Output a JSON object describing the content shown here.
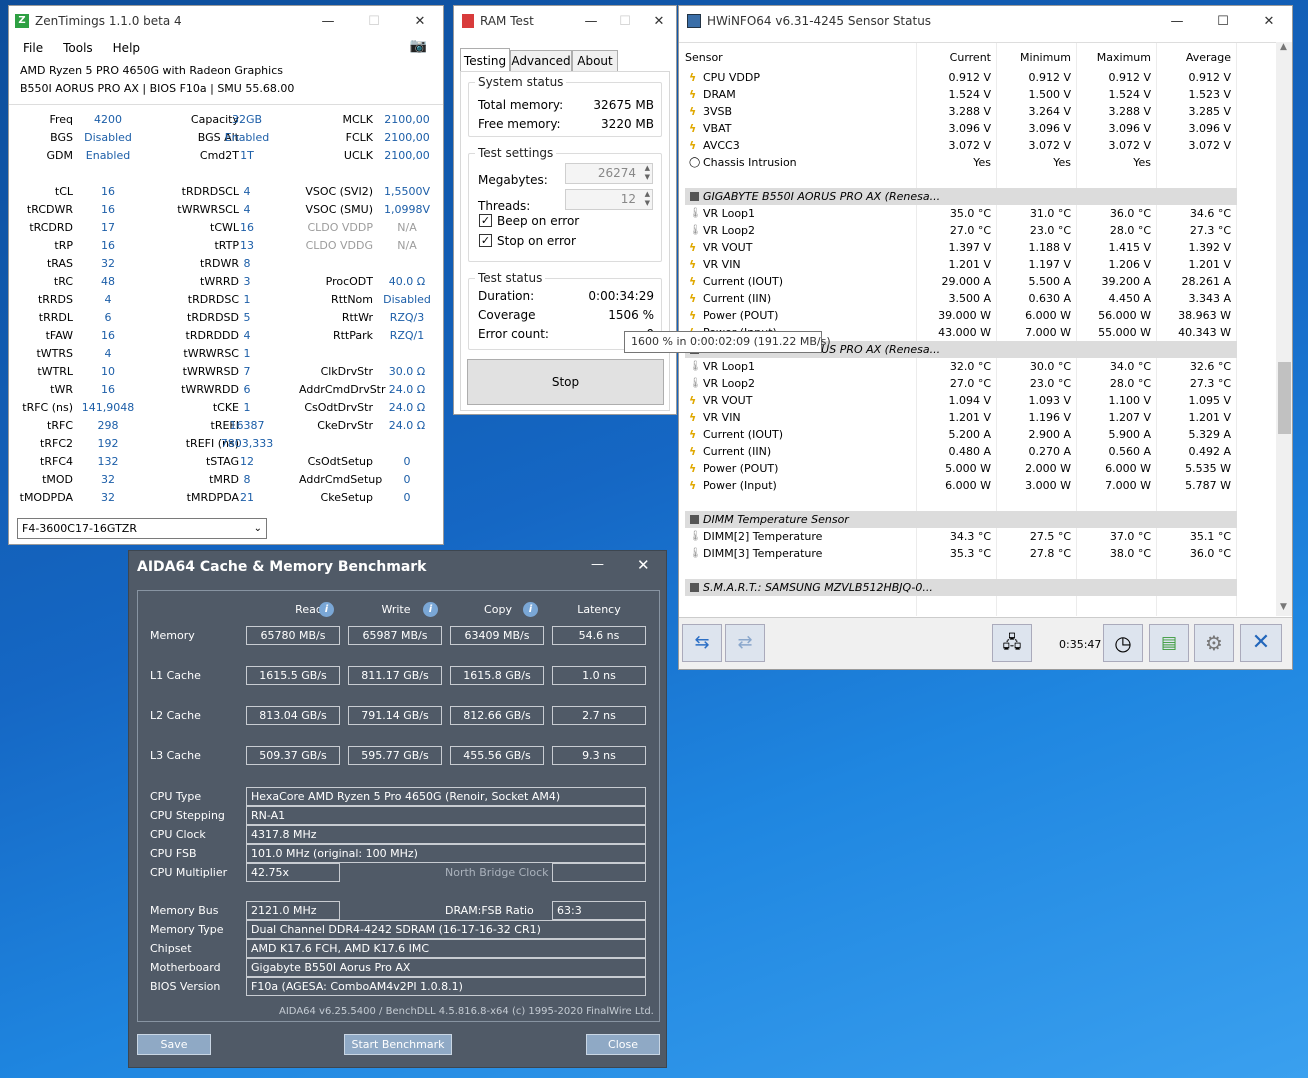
{
  "zen": {
    "title": "ZenTimings 1.1.0 beta 4",
    "menu": [
      "File",
      "Tools",
      "Help"
    ],
    "cpu": "AMD Ryzen 5 PRO 4650G with Radeon Graphics",
    "board": "B550I AORUS PRO AX | BIOS F10a | SMU 55.68.00",
    "rows": [
      [
        "Freq",
        "4200",
        "Capacity",
        "32GB",
        "MCLK",
        "2100,00"
      ],
      [
        "BGS",
        "Disabled",
        "BGS Alt",
        "Enabled",
        "FCLK",
        "2100,00"
      ],
      [
        "GDM",
        "Enabled",
        "Cmd2T",
        "1T",
        "UCLK",
        "2100,00"
      ],
      null,
      [
        "tCL",
        "16",
        "tRDRDSCL",
        "4",
        "VSOC (SVI2)",
        "1,5500V"
      ],
      [
        "tRCDWR",
        "16",
        "tWRWRSCL",
        "4",
        "VSOC (SMU)",
        "1,0998V"
      ],
      [
        "tRCDRD",
        "17",
        "tCWL",
        "16",
        "CLDO VDDP",
        "N/A"
      ],
      [
        "tRP",
        "16",
        "tRTP",
        "13",
        "CLDO VDDG",
        "N/A"
      ],
      [
        "tRAS",
        "32",
        "tRDWR",
        "8",
        "",
        ""
      ],
      [
        "tRC",
        "48",
        "tWRRD",
        "3",
        "ProcODT",
        "40.0 Ω"
      ],
      [
        "tRRDS",
        "4",
        "tRDRDSC",
        "1",
        "RttNom",
        "Disabled"
      ],
      [
        "tRRDL",
        "6",
        "tRDRDSD",
        "5",
        "RttWr",
        "RZQ/3"
      ],
      [
        "tFAW",
        "16",
        "tRDRDDD",
        "4",
        "RttPark",
        "RZQ/1"
      ],
      [
        "tWTRS",
        "4",
        "tWRWRSC",
        "1",
        "",
        ""
      ],
      [
        "tWTRL",
        "10",
        "tWRWRSD",
        "7",
        "ClkDrvStr",
        "30.0 Ω"
      ],
      [
        "tWR",
        "16",
        "tWRWRDD",
        "6",
        "AddrCmdDrvStr",
        "24.0 Ω"
      ],
      [
        "tRFC (ns)",
        "141,9048",
        "tCKE",
        "1",
        "CsOdtDrvStr",
        "24.0 Ω"
      ],
      [
        "tRFC",
        "298",
        "tREFI",
        "16387",
        "CkeDrvStr",
        "24.0 Ω"
      ],
      [
        "tRFC2",
        "192",
        "tREFI (ns)",
        "7803,333",
        "",
        ""
      ],
      [
        "tRFC4",
        "132",
        "tSTAG",
        "12",
        "CsOdtSetup",
        "0"
      ],
      [
        "tMOD",
        "32",
        "tMRD",
        "8",
        "AddrCmdSetup",
        "0"
      ],
      [
        "tMODPDA",
        "32",
        "tMRDPDA",
        "21",
        "CkeSetup",
        "0"
      ]
    ],
    "profile": "F4-3600C17-16GTZR"
  },
  "ram": {
    "title": "RAM Test",
    "tabs": [
      "Testing",
      "Advanced",
      "About"
    ],
    "status_title": "System status",
    "total_label": "Total memory:",
    "total_value": "32675 MB",
    "free_label": "Free memory:",
    "free_value": "3220 MB",
    "settings_title": "Test settings",
    "mb_label": "Megabytes:",
    "mb_value": "26274",
    "threads_label": "Threads:",
    "threads_value": "12",
    "beep_label": "Beep on error",
    "stop_err_label": "Stop on error",
    "test_status_title": "Test status",
    "duration_label": "Duration:",
    "duration_value": "0:00:34:29",
    "coverage_label": "Coverage",
    "coverage_value": "1506 %",
    "errors_label": "Error count:",
    "errors_value": "0",
    "tooltip": "1600 % in 0:00:02:09 (191.22 MB/s)",
    "stop_button": "Stop"
  },
  "hw": {
    "title": "HWiNFO64 v6.31-4245 Sensor Status",
    "headers": [
      "Sensor",
      "Current",
      "Minimum",
      "Maximum",
      "Average"
    ],
    "rows": [
      {
        "n": "CPU VDDP",
        "v": [
          "0.912 V",
          "0.912 V",
          "0.912 V",
          "0.912 V"
        ],
        "i": "bolt"
      },
      {
        "n": "DRAM",
        "v": [
          "1.524 V",
          "1.500 V",
          "1.524 V",
          "1.523 V"
        ],
        "i": "bolt"
      },
      {
        "n": "3VSB",
        "v": [
          "3.288 V",
          "3.264 V",
          "3.288 V",
          "3.285 V"
        ],
        "i": "bolt"
      },
      {
        "n": "VBAT",
        "v": [
          "3.096 V",
          "3.096 V",
          "3.096 V",
          "3.096 V"
        ],
        "i": "bolt"
      },
      {
        "n": "AVCC3",
        "v": [
          "3.072 V",
          "3.072 V",
          "3.072 V",
          "3.072 V"
        ],
        "i": "bolt"
      },
      {
        "n": "Chassis Intrusion",
        "v": [
          "Yes",
          "Yes",
          "Yes",
          ""
        ],
        "i": "circle"
      },
      {
        "blank": true
      },
      {
        "sec": "GIGABYTE B550I AORUS PRO AX (Renesa..."
      },
      {
        "n": "VR Loop1",
        "v": [
          "35.0 °C",
          "31.0 °C",
          "36.0 °C",
          "34.6 °C"
        ],
        "i": "therm"
      },
      {
        "n": "VR Loop2",
        "v": [
          "27.0 °C",
          "23.0 °C",
          "28.0 °C",
          "27.3 °C"
        ],
        "i": "therm"
      },
      {
        "n": "VR VOUT",
        "v": [
          "1.397 V",
          "1.188 V",
          "1.415 V",
          "1.392 V"
        ],
        "i": "bolt"
      },
      {
        "n": "VR VIN",
        "v": [
          "1.201 V",
          "1.197 V",
          "1.206 V",
          "1.201 V"
        ],
        "i": "bolt"
      },
      {
        "n": "Current (IOUT)",
        "v": [
          "29.000 A",
          "5.500 A",
          "39.200 A",
          "28.261 A"
        ],
        "i": "bolt"
      },
      {
        "n": "Current (IIN)",
        "v": [
          "3.500 A",
          "0.630 A",
          "4.450 A",
          "3.343 A"
        ],
        "i": "bolt"
      },
      {
        "n": "Power (POUT)",
        "v": [
          "39.000 W",
          "6.000 W",
          "56.000 W",
          "38.963 W"
        ],
        "i": "bolt"
      },
      {
        "n": "Power (Input)",
        "v": [
          "43.000 W",
          "7.000 W",
          "55.000 W",
          "40.343 W"
        ],
        "i": "bolt"
      },
      {
        "sec": "GIGABYTE B550I AORUS PRO AX (Renesa..."
      },
      {
        "n": "VR Loop1",
        "v": [
          "32.0 °C",
          "30.0 °C",
          "34.0 °C",
          "32.6 °C"
        ],
        "i": "therm"
      },
      {
        "n": "VR Loop2",
        "v": [
          "27.0 °C",
          "23.0 °C",
          "28.0 °C",
          "27.3 °C"
        ],
        "i": "therm"
      },
      {
        "n": "VR VOUT",
        "v": [
          "1.094 V",
          "1.093 V",
          "1.100 V",
          "1.095 V"
        ],
        "i": "bolt"
      },
      {
        "n": "VR VIN",
        "v": [
          "1.201 V",
          "1.196 V",
          "1.207 V",
          "1.201 V"
        ],
        "i": "bolt"
      },
      {
        "n": "Current (IOUT)",
        "v": [
          "5.200 A",
          "2.900 A",
          "5.900 A",
          "5.329 A"
        ],
        "i": "bolt"
      },
      {
        "n": "Current (IIN)",
        "v": [
          "0.480 A",
          "0.270 A",
          "0.560 A",
          "0.492 A"
        ],
        "i": "bolt"
      },
      {
        "n": "Power (POUT)",
        "v": [
          "5.000 W",
          "2.000 W",
          "6.000 W",
          "5.535 W"
        ],
        "i": "bolt"
      },
      {
        "n": "Power (Input)",
        "v": [
          "6.000 W",
          "3.000 W",
          "7.000 W",
          "5.787 W"
        ],
        "i": "bolt"
      },
      {
        "blank": true
      },
      {
        "sec": "DIMM Temperature Sensor"
      },
      {
        "n": "DIMM[2] Temperature",
        "v": [
          "34.3 °C",
          "27.5 °C",
          "37.0 °C",
          "35.1 °C"
        ],
        "i": "therm"
      },
      {
        "n": "DIMM[3] Temperature",
        "v": [
          "35.3 °C",
          "27.8 °C",
          "38.0 °C",
          "36.0 °C"
        ],
        "i": "therm"
      },
      {
        "blank": true
      },
      {
        "sec": "S.M.A.R.T.: SAMSUNG MZVLB512HBJQ-0..."
      }
    ],
    "timer": "0:35:47"
  },
  "aida": {
    "title": "AIDA64 Cache & Memory Benchmark",
    "headers": [
      "Read",
      "Write",
      "Copy",
      "Latency"
    ],
    "bench": [
      {
        "label": "Memory",
        "v": [
          "65780 MB/s",
          "65987 MB/s",
          "63409 MB/s",
          "54.6 ns"
        ]
      },
      {
        "label": "L1 Cache",
        "v": [
          "1615.5 GB/s",
          "811.17 GB/s",
          "1615.8 GB/s",
          "1.0 ns"
        ]
      },
      {
        "label": "L2 Cache",
        "v": [
          "813.04 GB/s",
          "791.14 GB/s",
          "812.66 GB/s",
          "2.7 ns"
        ]
      },
      {
        "label": "L3 Cache",
        "v": [
          "509.37 GB/s",
          "595.77 GB/s",
          "455.56 GB/s",
          "9.3 ns"
        ]
      }
    ],
    "cpu_type_label": "CPU Type",
    "cpu_type": "HexaCore AMD Ryzen 5 Pro 4650G  (Renoir, Socket AM4)",
    "cpu_stepping_label": "CPU Stepping",
    "cpu_stepping": "RN-A1",
    "cpu_clock_label": "CPU Clock",
    "cpu_clock": "4317.8 MHz",
    "cpu_fsb_label": "CPU FSB",
    "cpu_fsb": "101.0 MHz  (original: 100 MHz)",
    "cpu_mult_label": "CPU Multiplier",
    "cpu_mult": "42.75x",
    "nb_clock_label": "North Bridge Clock",
    "nb_clock": "",
    "mem_bus_label": "Memory Bus",
    "mem_bus": "2121.0 MHz",
    "ratio_label": "DRAM:FSB Ratio",
    "ratio": "63:3",
    "mem_type_label": "Memory Type",
    "mem_type": "Dual Channel DDR4-4242 SDRAM  (16-17-16-32 CR1)",
    "chipset_label": "Chipset",
    "chipset": "AMD K17.6 FCH, AMD K17.6 IMC",
    "mobo_label": "Motherboard",
    "mobo": "Gigabyte B550I Aorus Pro AX",
    "bios_label": "BIOS Version",
    "bios": "F10a  (AGESA: ComboAM4v2PI 1.0.8.1)",
    "footer": "AIDA64 v6.25.5400 / BenchDLL 4.5.816.8-x64  (c) 1995-2020 FinalWire Ltd.",
    "save": "Save",
    "start": "Start Benchmark",
    "close": "Close"
  },
  "icons": {
    "info": "i",
    "check": "✓"
  }
}
